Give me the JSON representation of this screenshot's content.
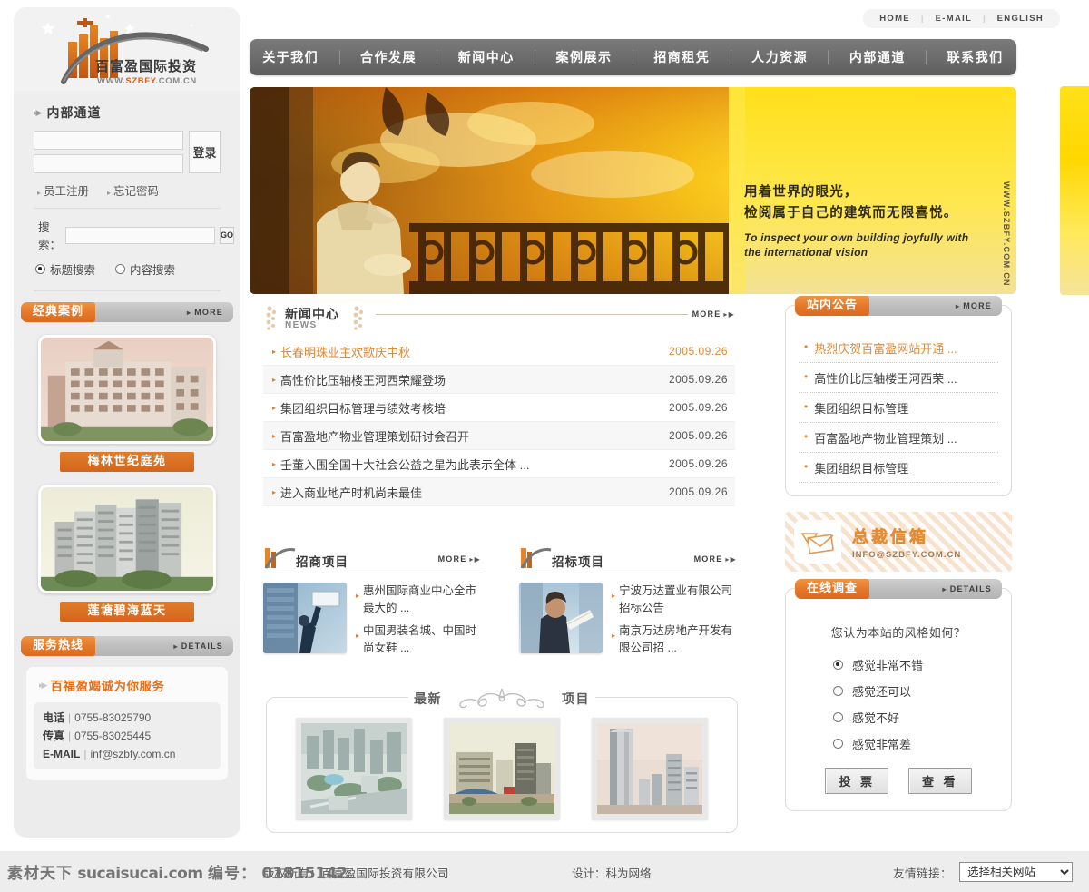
{
  "brand": {
    "name_cn": "百富盈国际投资",
    "url": "WWW.SZBFY.COM.CN",
    "url_prefix": "WWW.",
    "url_mid": "SZBFY",
    "url_suffix": ".COM.CN"
  },
  "toplinks": {
    "home": "HOME",
    "email": "E-MAIL",
    "english": "ENGLISH",
    "sep": "|"
  },
  "mainnav": {
    "items": [
      {
        "label": "关于我们"
      },
      {
        "label": "合作发展"
      },
      {
        "label": "新闻中心"
      },
      {
        "label": "案例展示"
      },
      {
        "label": "招商租凭"
      },
      {
        "label": "人力资源"
      },
      {
        "label": "内部通道"
      },
      {
        "label": "联系我们"
      }
    ]
  },
  "sidebar": {
    "channel": {
      "title": "内部通道",
      "user_placeholder": "",
      "pass_placeholder": "",
      "login_label": "登录",
      "register_label": "员工注册",
      "forgot_label": "忘记密码"
    },
    "search": {
      "label": "搜索：",
      "value": "",
      "placeholder": "",
      "go_label": "GO",
      "option_title": "标题搜索",
      "option_content": "内容搜索",
      "selected": "标题搜索"
    },
    "cases": {
      "head_label": "经典案例",
      "more_label": "MORE",
      "items": [
        {
          "caption": "梅林世纪庭苑"
        },
        {
          "caption": "莲塘碧海蓝天"
        }
      ]
    },
    "hotline": {
      "head_label": "服务热线",
      "details_label": "DETAILS",
      "slogan": "百福盈竭诚为你服务",
      "rows": [
        {
          "label": "电话",
          "value": "0755-83025790"
        },
        {
          "label": "传真",
          "value": "0755-83025445"
        },
        {
          "label": "E-MAIL",
          "value": "inf@szbfy.com.cn"
        }
      ]
    }
  },
  "banner": {
    "line1": "用着世界的眼光，",
    "line2": "检阅属于自己的建筑而无限喜悦。",
    "en_line1": "To inspect your own building joyfully with",
    "en_line2": "the international vision",
    "vertical_url": "WWW.SZBFY.COM.CN"
  },
  "news": {
    "title_cn": "新闻中心",
    "title_en": "NEWS",
    "more_label": "MORE",
    "items": [
      {
        "title": "长春明珠业主欢歌庆中秋",
        "date": "2005.09.26"
      },
      {
        "title": "高性价比压轴楼王河西荣耀登场",
        "date": "2005.09.26"
      },
      {
        "title": "集团组织目标管理与绩效考核培",
        "date": "2005.09.26"
      },
      {
        "title": "百富盈地产物业管理策划研讨会召开",
        "date": "2005.09.26"
      },
      {
        "title": "壬董入围全国十大社会公益之星为此表示全体 ...",
        "date": "2005.09.26"
      },
      {
        "title": "进入商业地产时机尚未最佳",
        "date": "2005.09.26"
      }
    ]
  },
  "projects": [
    {
      "title": "招商项目",
      "more_label": "MORE",
      "links": [
        "惠州国际商业中心全市最大的 ...",
        "中国男装名城、中国时尚女鞋 ..."
      ]
    },
    {
      "title": "招标项目",
      "more_label": "MORE",
      "links": [
        "宁波万达置业有限公司招标公告",
        "南京万达房地产开发有限公司招 ..."
      ]
    }
  ],
  "latest": {
    "word_left": "最新",
    "word_right": "项目"
  },
  "notices": {
    "head_label": "站内公告",
    "more_label": "MORE",
    "items": [
      "热烈庆贺百富盈网站开通 ...",
      "高性价比压轴楼王河西荣 ...",
      "集团组织目标管理",
      "百富盈地产物业管理策划 ...",
      "集团组织目标管理"
    ]
  },
  "mailbox": {
    "title": "总裁信箱",
    "email": "INFO@SZBFY.COM.CN"
  },
  "poll": {
    "head_label": "在线调查",
    "details_label": "DETAILS",
    "question": "您认为本站的风格如何？",
    "options": [
      "感觉非常不错",
      "感觉还可以",
      "感觉不好",
      "感觉非常差"
    ],
    "selected": "感觉非常不错",
    "vote_label": "投 票",
    "view_label": "查 看"
  },
  "footer": {
    "copyright": "版权所有：百富盈国际投资有限公司",
    "design": "设计：科为网络",
    "links_label": "友情链接：",
    "select_value": "选择相关网站",
    "watermark_cn": "素材天下",
    "watermark_site": "sucaisucai.com",
    "watermark_id_label": "编号：",
    "watermark_id": "01815142"
  },
  "colors": {
    "accent": "#e0762a",
    "nav_bg": "#6e6e6e",
    "sidebar_bg": "#eeeeee",
    "banner_yellow": "#ffd700"
  }
}
